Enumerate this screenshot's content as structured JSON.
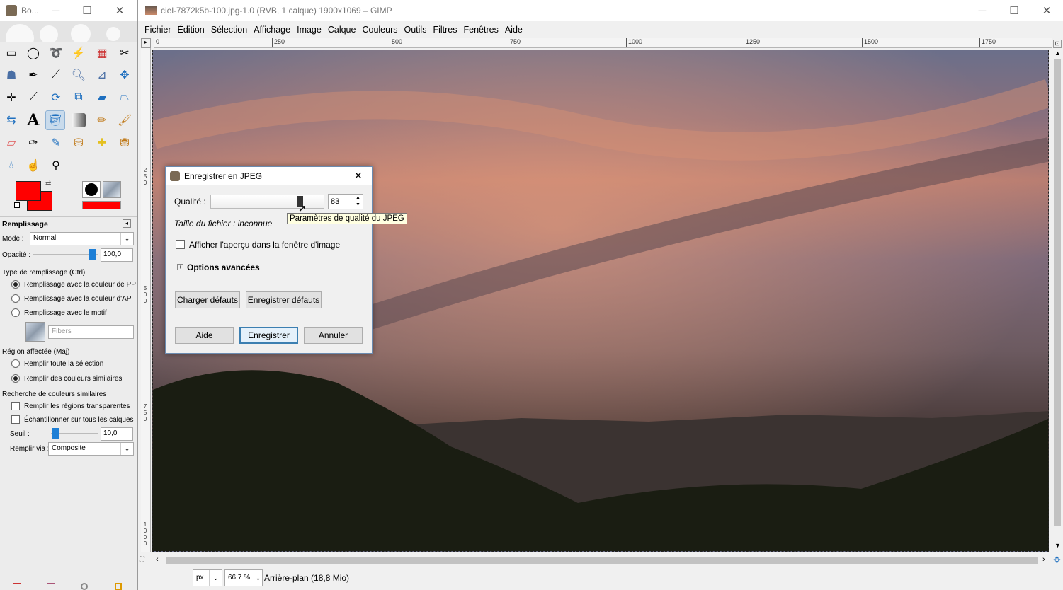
{
  "toolbox": {
    "title": "Bo...",
    "minimize": "─",
    "maximize": "☐",
    "close": "✕",
    "tool_options_title": "Remplissage",
    "mode_label": "Mode :",
    "mode_value": "Normal",
    "opacity_label": "Opacité :",
    "opacity_value": "100,0",
    "opacity_level_percent": 100,
    "fill_type_label": "Type de remplissage  (Ctrl)",
    "fill_fg": "Remplissage avec la couleur de PP",
    "fill_bg": "Remplissage avec la couleur d'AP",
    "fill_pattern": "Remplissage avec le motif",
    "pattern_name": "Fibers",
    "region_label": "Région affectée  (Maj)",
    "region_selection": "Remplir toute la sélection",
    "region_similar": "Remplir des couleurs similaires",
    "similar_label": "Recherche de couleurs similaires",
    "fill_transparent": "Remplir les régions transparentes",
    "sample_merged": "Échantillonner sur tous les calques",
    "threshold_label": "Seuil :",
    "threshold_value": "10,0",
    "threshold_level_percent": 4,
    "fill_by_label": "Remplir via :",
    "fill_by_value": "Composite",
    "fg_color": "#ff0000",
    "bg_color": "#ff0000"
  },
  "main": {
    "title": "ciel-7872k5b-100.jpg-1.0 (RVB, 1 calque) 1900x1069 – GIMP",
    "minimize": "─",
    "maximize": "☐",
    "close": "✕",
    "menu": [
      "Fichier",
      "Édition",
      "Sélection",
      "Affichage",
      "Image",
      "Calque",
      "Couleurs",
      "Outils",
      "Filtres",
      "Fenêtres",
      "Aide"
    ],
    "ruler_h": [
      "0",
      "250",
      "500",
      "750",
      "1000",
      "1250",
      "1500",
      "1750"
    ],
    "ruler_v": [
      "2 5 0",
      "5 0 0",
      "7 5 0",
      "1 0 0 0"
    ],
    "unit": "px",
    "zoom": "66,7 %",
    "status": "Arrière-plan (18,8 Mio)"
  },
  "dialog": {
    "title": "Enregistrer en JPEG",
    "close": "✕",
    "quality_label": "Qualité :",
    "quality_value": "83",
    "quality_level": 83,
    "file_size": "Taille du fichier : inconnue",
    "preview_label": "Afficher l'aperçu dans la fenêtre d'image",
    "advanced_label": "Options avancées",
    "load_defaults": "Charger défauts",
    "save_defaults": "Enregistrer défauts",
    "help": "Aide",
    "save": "Enregistrer",
    "cancel": "Annuler",
    "tooltip": "Paramètres de qualité du JPEG"
  }
}
